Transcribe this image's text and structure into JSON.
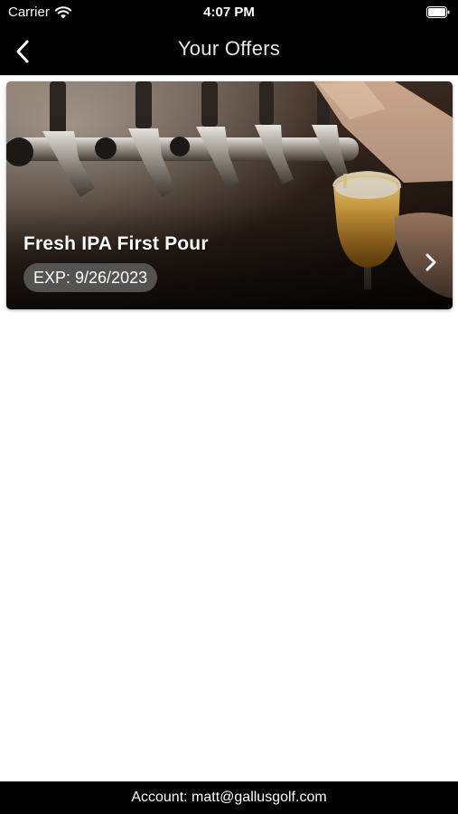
{
  "status_bar": {
    "carrier": "Carrier",
    "time": "4:07 PM",
    "wifi_icon": "wifi-icon",
    "battery_icon": "battery-icon"
  },
  "nav": {
    "title": "Your Offers",
    "back_icon": "chevron-left-icon"
  },
  "offers": [
    {
      "title": "Fresh IPA First Pour",
      "expiration": "EXP: 9/26/2023",
      "image": "beer-tap-photo",
      "chevron_icon": "chevron-right-icon"
    }
  ],
  "footer": {
    "account": "Account: matt@gallusgolf.com"
  },
  "colors": {
    "bar_background": "#000000",
    "page_background": "#ffffff",
    "badge_background": "#5f5f5f",
    "text_on_dark": "#ffffff"
  }
}
